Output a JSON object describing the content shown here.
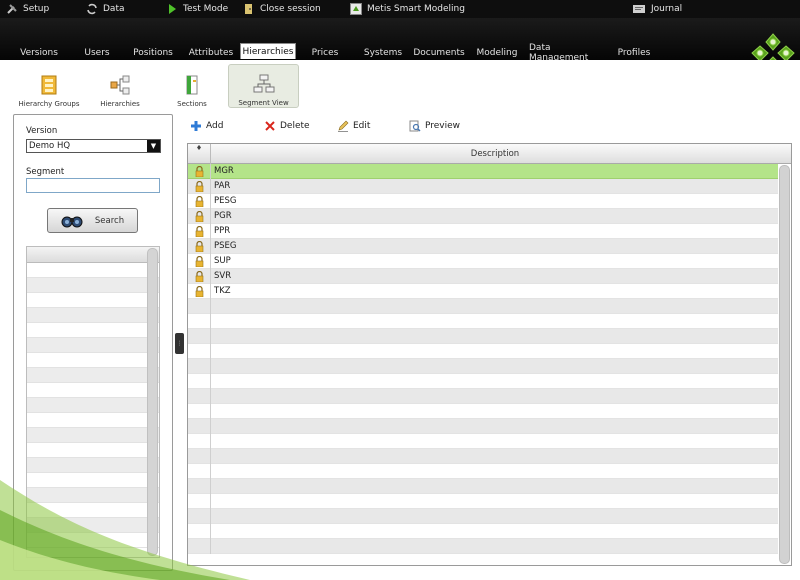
{
  "topbar": {
    "items": [
      {
        "label": "Setup",
        "icon": "tools-icon"
      },
      {
        "label": "Data",
        "icon": "sync-icon"
      },
      {
        "label": "Test Mode",
        "icon": "play-icon"
      },
      {
        "label": "Close session",
        "icon": "door-icon"
      },
      {
        "label": "Metis Smart Modeling",
        "icon": "app-icon"
      },
      {
        "label": "Journal",
        "icon": "journal-icon"
      }
    ]
  },
  "tabs": [
    {
      "label": "Versions"
    },
    {
      "label": "Users"
    },
    {
      "label": "Positions"
    },
    {
      "label": "Attributes"
    },
    {
      "label": "Hierarchies",
      "active": true
    },
    {
      "label": "Prices"
    },
    {
      "label": "Systems"
    },
    {
      "label": "Documents"
    },
    {
      "label": "Modeling"
    },
    {
      "label": "Data Management"
    },
    {
      "label": "Profiles"
    }
  ],
  "toolbar": {
    "buttons": [
      {
        "label": "Hierarchy Groups",
        "icon": "hierarchy-groups-icon"
      },
      {
        "label": "Hierarchies",
        "icon": "hierarchies-icon"
      },
      {
        "label": "Sections",
        "icon": "sections-icon"
      },
      {
        "label": "Segment View",
        "icon": "segment-view-icon",
        "active": true
      }
    ]
  },
  "filters": {
    "version_label": "Version",
    "version_value": "Demo HQ",
    "segment_label": "Segment",
    "segment_value": "",
    "search_label": "Search"
  },
  "actions": {
    "add": "Add",
    "delete": "Delete",
    "edit": "Edit",
    "preview": "Preview"
  },
  "grid": {
    "sort_glyph": "♦",
    "column_description": "Description",
    "selected_index": 0,
    "rows": [
      "MGR",
      "PAR",
      "PESG",
      "PGR",
      "PPR",
      "PSEG",
      "SUP",
      "SVR",
      "TKZ"
    ]
  },
  "colors": {
    "selected_row": "#b4e489",
    "accent_green": "#5aa21c"
  }
}
